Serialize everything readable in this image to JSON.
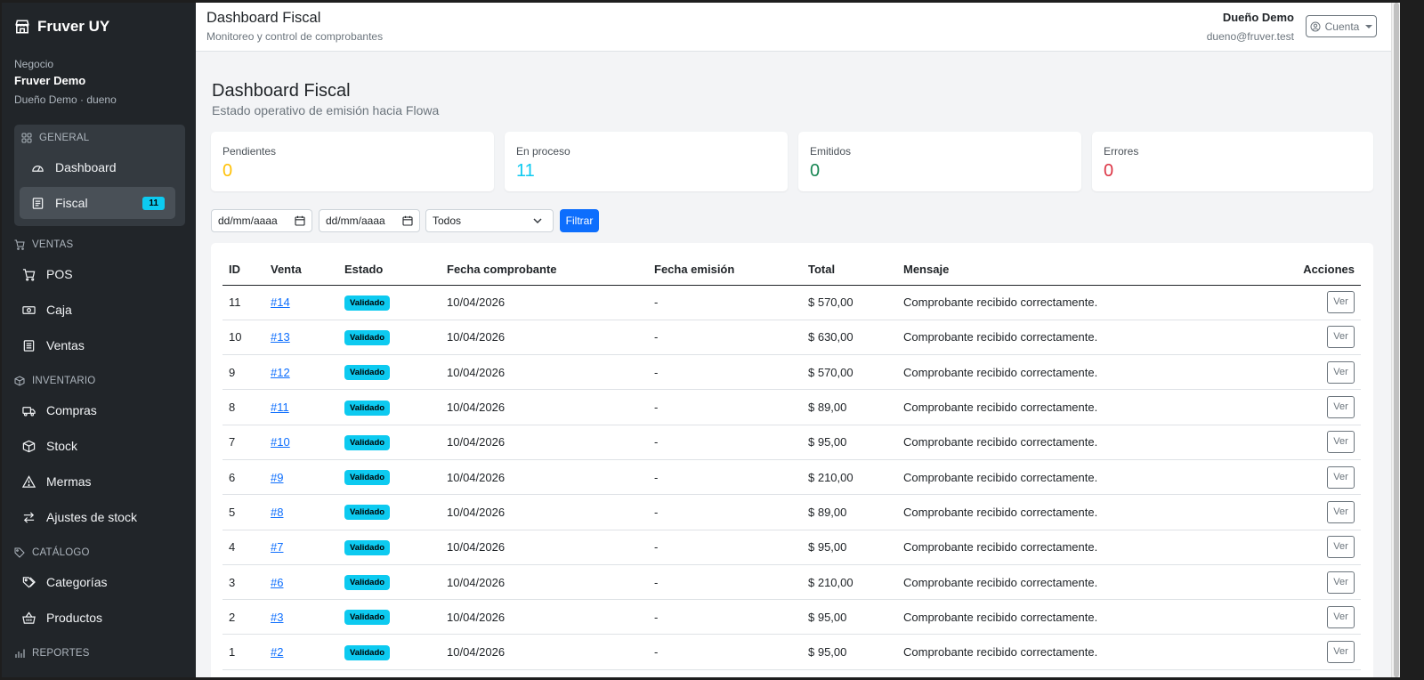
{
  "brand": {
    "name": "Fruver UY",
    "icon": "shop-icon"
  },
  "business": {
    "label": "Negocio",
    "name": "Fruver Demo",
    "user": "Dueño Demo · dueno"
  },
  "sidebar": {
    "sections": [
      {
        "title": "GENERAL",
        "icon": "grid-icon",
        "items": [
          {
            "label": "Dashboard",
            "icon": "speedometer-icon"
          },
          {
            "label": "Fiscal",
            "icon": "receipt-icon",
            "badge": "11",
            "active": true
          }
        ]
      },
      {
        "title": "VENTAS",
        "icon": "cart-icon",
        "items": [
          {
            "label": "POS",
            "icon": "cart-icon"
          },
          {
            "label": "Caja",
            "icon": "cash-icon"
          },
          {
            "label": "Ventas",
            "icon": "list-icon"
          }
        ]
      },
      {
        "title": "INVENTARIO",
        "icon": "box-icon",
        "items": [
          {
            "label": "Compras",
            "icon": "truck-icon"
          },
          {
            "label": "Stock",
            "icon": "box-icon"
          },
          {
            "label": "Mermas",
            "icon": "warning-icon"
          },
          {
            "label": "Ajustes de stock",
            "icon": "arrows-icon"
          }
        ]
      },
      {
        "title": "CATÁLOGO",
        "icon": "tag-icon",
        "items": [
          {
            "label": "Categorías",
            "icon": "tags-icon"
          },
          {
            "label": "Productos",
            "icon": "basket-icon"
          }
        ]
      },
      {
        "title": "REPORTES",
        "icon": "chart-icon",
        "items": []
      }
    ]
  },
  "header": {
    "title": "Dashboard Fiscal",
    "subtitle": "Monitoreo y control de comprobantes",
    "user_name": "Dueño Demo",
    "user_email": "dueno@fruver.test",
    "account_label": "Cuenta"
  },
  "page": {
    "title": "Dashboard Fiscal",
    "subtitle": "Estado operativo de emisión hacia Flowa"
  },
  "stats": [
    {
      "label": "Pendientes",
      "value": "0",
      "color": "#ffc107"
    },
    {
      "label": "En proceso",
      "value": "11",
      "color": "#0dcaf0"
    },
    {
      "label": "Emitidos",
      "value": "0",
      "color": "#198754"
    },
    {
      "label": "Errores",
      "value": "0",
      "color": "#dc3545"
    }
  ],
  "filters": {
    "date_from": "dd/mm/aaaa",
    "date_to": "dd/mm/aaaa",
    "status": "Todos",
    "button": "Filtrar"
  },
  "table": {
    "headers": [
      "ID",
      "Venta",
      "Estado",
      "Fecha comprobante",
      "Fecha emisión",
      "Total",
      "Mensaje",
      "Acciones"
    ],
    "action_label": "Ver",
    "rows": [
      {
        "id": "11",
        "venta": "#14",
        "estado": "Validado",
        "fecha": "10/04/2026",
        "emision": "-",
        "total": "$ 570,00",
        "mensaje": "Comprobante recibido correctamente."
      },
      {
        "id": "10",
        "venta": "#13",
        "estado": "Validado",
        "fecha": "10/04/2026",
        "emision": "-",
        "total": "$ 630,00",
        "mensaje": "Comprobante recibido correctamente."
      },
      {
        "id": "9",
        "venta": "#12",
        "estado": "Validado",
        "fecha": "10/04/2026",
        "emision": "-",
        "total": "$ 570,00",
        "mensaje": "Comprobante recibido correctamente."
      },
      {
        "id": "8",
        "venta": "#11",
        "estado": "Validado",
        "fecha": "10/04/2026",
        "emision": "-",
        "total": "$ 89,00",
        "mensaje": "Comprobante recibido correctamente."
      },
      {
        "id": "7",
        "venta": "#10",
        "estado": "Validado",
        "fecha": "10/04/2026",
        "emision": "-",
        "total": "$ 95,00",
        "mensaje": "Comprobante recibido correctamente."
      },
      {
        "id": "6",
        "venta": "#9",
        "estado": "Validado",
        "fecha": "10/04/2026",
        "emision": "-",
        "total": "$ 210,00",
        "mensaje": "Comprobante recibido correctamente."
      },
      {
        "id": "5",
        "venta": "#8",
        "estado": "Validado",
        "fecha": "10/04/2026",
        "emision": "-",
        "total": "$ 89,00",
        "mensaje": "Comprobante recibido correctamente."
      },
      {
        "id": "4",
        "venta": "#7",
        "estado": "Validado",
        "fecha": "10/04/2026",
        "emision": "-",
        "total": "$ 95,00",
        "mensaje": "Comprobante recibido correctamente."
      },
      {
        "id": "3",
        "venta": "#6",
        "estado": "Validado",
        "fecha": "10/04/2026",
        "emision": "-",
        "total": "$ 210,00",
        "mensaje": "Comprobante recibido correctamente."
      },
      {
        "id": "2",
        "venta": "#3",
        "estado": "Validado",
        "fecha": "10/04/2026",
        "emision": "-",
        "total": "$ 95,00",
        "mensaje": "Comprobante recibido correctamente."
      },
      {
        "id": "1",
        "venta": "#2",
        "estado": "Validado",
        "fecha": "10/04/2026",
        "emision": "-",
        "total": "$ 95,00",
        "mensaje": "Comprobante recibido correctamente."
      }
    ]
  }
}
